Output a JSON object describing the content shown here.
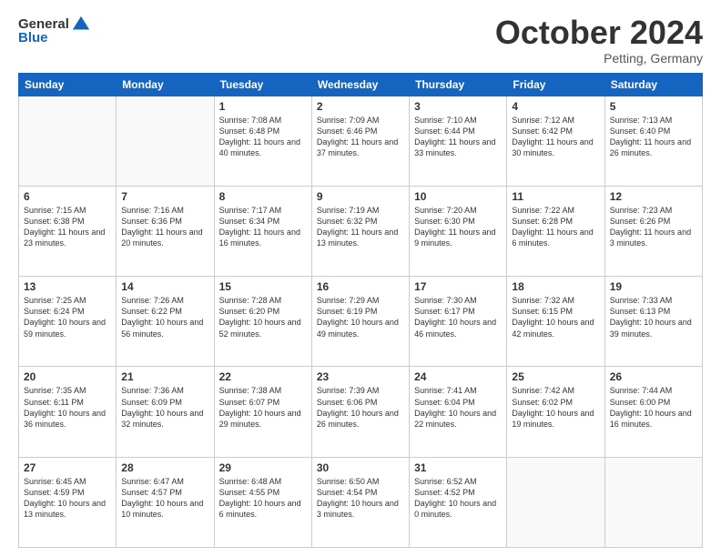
{
  "header": {
    "logo_general": "General",
    "logo_blue": "Blue",
    "month_title": "October 2024",
    "location": "Petting, Germany"
  },
  "days_of_week": [
    "Sunday",
    "Monday",
    "Tuesday",
    "Wednesday",
    "Thursday",
    "Friday",
    "Saturday"
  ],
  "weeks": [
    [
      {
        "day": "",
        "sunrise": "",
        "sunset": "",
        "daylight": ""
      },
      {
        "day": "",
        "sunrise": "",
        "sunset": "",
        "daylight": ""
      },
      {
        "day": "1",
        "sunrise": "Sunrise: 7:08 AM",
        "sunset": "Sunset: 6:48 PM",
        "daylight": "Daylight: 11 hours and 40 minutes."
      },
      {
        "day": "2",
        "sunrise": "Sunrise: 7:09 AM",
        "sunset": "Sunset: 6:46 PM",
        "daylight": "Daylight: 11 hours and 37 minutes."
      },
      {
        "day": "3",
        "sunrise": "Sunrise: 7:10 AM",
        "sunset": "Sunset: 6:44 PM",
        "daylight": "Daylight: 11 hours and 33 minutes."
      },
      {
        "day": "4",
        "sunrise": "Sunrise: 7:12 AM",
        "sunset": "Sunset: 6:42 PM",
        "daylight": "Daylight: 11 hours and 30 minutes."
      },
      {
        "day": "5",
        "sunrise": "Sunrise: 7:13 AM",
        "sunset": "Sunset: 6:40 PM",
        "daylight": "Daylight: 11 hours and 26 minutes."
      }
    ],
    [
      {
        "day": "6",
        "sunrise": "Sunrise: 7:15 AM",
        "sunset": "Sunset: 6:38 PM",
        "daylight": "Daylight: 11 hours and 23 minutes."
      },
      {
        "day": "7",
        "sunrise": "Sunrise: 7:16 AM",
        "sunset": "Sunset: 6:36 PM",
        "daylight": "Daylight: 11 hours and 20 minutes."
      },
      {
        "day": "8",
        "sunrise": "Sunrise: 7:17 AM",
        "sunset": "Sunset: 6:34 PM",
        "daylight": "Daylight: 11 hours and 16 minutes."
      },
      {
        "day": "9",
        "sunrise": "Sunrise: 7:19 AM",
        "sunset": "Sunset: 6:32 PM",
        "daylight": "Daylight: 11 hours and 13 minutes."
      },
      {
        "day": "10",
        "sunrise": "Sunrise: 7:20 AM",
        "sunset": "Sunset: 6:30 PM",
        "daylight": "Daylight: 11 hours and 9 minutes."
      },
      {
        "day": "11",
        "sunrise": "Sunrise: 7:22 AM",
        "sunset": "Sunset: 6:28 PM",
        "daylight": "Daylight: 11 hours and 6 minutes."
      },
      {
        "day": "12",
        "sunrise": "Sunrise: 7:23 AM",
        "sunset": "Sunset: 6:26 PM",
        "daylight": "Daylight: 11 hours and 3 minutes."
      }
    ],
    [
      {
        "day": "13",
        "sunrise": "Sunrise: 7:25 AM",
        "sunset": "Sunset: 6:24 PM",
        "daylight": "Daylight: 10 hours and 59 minutes."
      },
      {
        "day": "14",
        "sunrise": "Sunrise: 7:26 AM",
        "sunset": "Sunset: 6:22 PM",
        "daylight": "Daylight: 10 hours and 56 minutes."
      },
      {
        "day": "15",
        "sunrise": "Sunrise: 7:28 AM",
        "sunset": "Sunset: 6:20 PM",
        "daylight": "Daylight: 10 hours and 52 minutes."
      },
      {
        "day": "16",
        "sunrise": "Sunrise: 7:29 AM",
        "sunset": "Sunset: 6:19 PM",
        "daylight": "Daylight: 10 hours and 49 minutes."
      },
      {
        "day": "17",
        "sunrise": "Sunrise: 7:30 AM",
        "sunset": "Sunset: 6:17 PM",
        "daylight": "Daylight: 10 hours and 46 minutes."
      },
      {
        "day": "18",
        "sunrise": "Sunrise: 7:32 AM",
        "sunset": "Sunset: 6:15 PM",
        "daylight": "Daylight: 10 hours and 42 minutes."
      },
      {
        "day": "19",
        "sunrise": "Sunrise: 7:33 AM",
        "sunset": "Sunset: 6:13 PM",
        "daylight": "Daylight: 10 hours and 39 minutes."
      }
    ],
    [
      {
        "day": "20",
        "sunrise": "Sunrise: 7:35 AM",
        "sunset": "Sunset: 6:11 PM",
        "daylight": "Daylight: 10 hours and 36 minutes."
      },
      {
        "day": "21",
        "sunrise": "Sunrise: 7:36 AM",
        "sunset": "Sunset: 6:09 PM",
        "daylight": "Daylight: 10 hours and 32 minutes."
      },
      {
        "day": "22",
        "sunrise": "Sunrise: 7:38 AM",
        "sunset": "Sunset: 6:07 PM",
        "daylight": "Daylight: 10 hours and 29 minutes."
      },
      {
        "day": "23",
        "sunrise": "Sunrise: 7:39 AM",
        "sunset": "Sunset: 6:06 PM",
        "daylight": "Daylight: 10 hours and 26 minutes."
      },
      {
        "day": "24",
        "sunrise": "Sunrise: 7:41 AM",
        "sunset": "Sunset: 6:04 PM",
        "daylight": "Daylight: 10 hours and 22 minutes."
      },
      {
        "day": "25",
        "sunrise": "Sunrise: 7:42 AM",
        "sunset": "Sunset: 6:02 PM",
        "daylight": "Daylight: 10 hours and 19 minutes."
      },
      {
        "day": "26",
        "sunrise": "Sunrise: 7:44 AM",
        "sunset": "Sunset: 6:00 PM",
        "daylight": "Daylight: 10 hours and 16 minutes."
      }
    ],
    [
      {
        "day": "27",
        "sunrise": "Sunrise: 6:45 AM",
        "sunset": "Sunset: 4:59 PM",
        "daylight": "Daylight: 10 hours and 13 minutes."
      },
      {
        "day": "28",
        "sunrise": "Sunrise: 6:47 AM",
        "sunset": "Sunset: 4:57 PM",
        "daylight": "Daylight: 10 hours and 10 minutes."
      },
      {
        "day": "29",
        "sunrise": "Sunrise: 6:48 AM",
        "sunset": "Sunset: 4:55 PM",
        "daylight": "Daylight: 10 hours and 6 minutes."
      },
      {
        "day": "30",
        "sunrise": "Sunrise: 6:50 AM",
        "sunset": "Sunset: 4:54 PM",
        "daylight": "Daylight: 10 hours and 3 minutes."
      },
      {
        "day": "31",
        "sunrise": "Sunrise: 6:52 AM",
        "sunset": "Sunset: 4:52 PM",
        "daylight": "Daylight: 10 hours and 0 minutes."
      },
      {
        "day": "",
        "sunrise": "",
        "sunset": "",
        "daylight": ""
      },
      {
        "day": "",
        "sunrise": "",
        "sunset": "",
        "daylight": ""
      }
    ]
  ]
}
